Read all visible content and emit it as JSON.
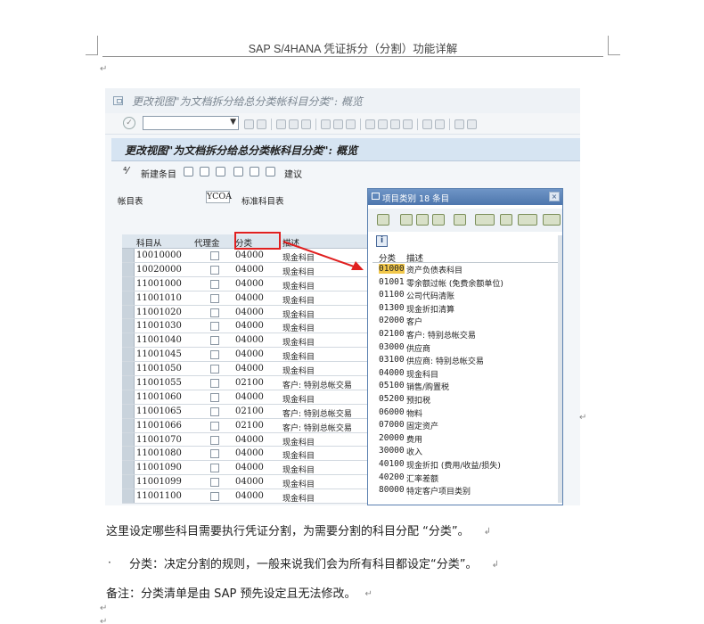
{
  "doc": {
    "header": "SAP S/4HANA 凭证拆分（分割）功能详解",
    "para_mark": "↵",
    "para_mark_alt": "↲"
  },
  "sap": {
    "window_title": "更改视图\"为文档拆分给总分类帐科目分类\": 概览",
    "view_title": "更改视图\"为文档拆分给总分类帐科目分类\": 概览",
    "toolbar": {
      "new_entry": "新建条目",
      "info": "建议"
    },
    "ledger": {
      "label": "帐目表",
      "value": "YCOA",
      "desc": "标准科目表"
    },
    "grid": {
      "headers": {
        "account_from": "科目从",
        "agent": "代理金",
        "category": "分类",
        "desc": "描述"
      },
      "rows": [
        {
          "account": "10010000",
          "category": "04000",
          "desc": "现金科目"
        },
        {
          "account": "10020000",
          "category": "04000",
          "desc": "现金科目"
        },
        {
          "account": "11001000",
          "category": "04000",
          "desc": "现金科目"
        },
        {
          "account": "11001010",
          "category": "04000",
          "desc": "现金科目"
        },
        {
          "account": "11001020",
          "category": "04000",
          "desc": "现金科目"
        },
        {
          "account": "11001030",
          "category": "04000",
          "desc": "现金科目"
        },
        {
          "account": "11001040",
          "category": "04000",
          "desc": "现金科目"
        },
        {
          "account": "11001045",
          "category": "04000",
          "desc": "现金科目"
        },
        {
          "account": "11001050",
          "category": "04000",
          "desc": "现金科目"
        },
        {
          "account": "11001055",
          "category": "02100",
          "desc": "客户: 特别总帐交易"
        },
        {
          "account": "11001060",
          "category": "04000",
          "desc": "现金科目"
        },
        {
          "account": "11001065",
          "category": "02100",
          "desc": "客户: 特别总帐交易"
        },
        {
          "account": "11001066",
          "category": "02100",
          "desc": "客户: 特别总帐交易"
        },
        {
          "account": "11001070",
          "category": "04000",
          "desc": "现金科目"
        },
        {
          "account": "11001080",
          "category": "04000",
          "desc": "现金科目"
        },
        {
          "account": "11001090",
          "category": "04000",
          "desc": "现金科目"
        },
        {
          "account": "11001099",
          "category": "04000",
          "desc": "现金科目"
        },
        {
          "account": "11001100",
          "category": "04000",
          "desc": "现金科目"
        }
      ]
    },
    "popup": {
      "title": "项目类别 18 条目",
      "close": "×",
      "info_icon": "i",
      "headers": {
        "code": "分类",
        "desc": "描述"
      },
      "items": [
        {
          "code": "01000",
          "desc": "资产负债表科目"
        },
        {
          "code": "01001",
          "desc": "零余额过帐 (免费余额单位)"
        },
        {
          "code": "01100",
          "desc": "公司代码清账"
        },
        {
          "code": "01300",
          "desc": "现金折扣清算"
        },
        {
          "code": "02000",
          "desc": "客户"
        },
        {
          "code": "02100",
          "desc": "客户: 特别总帐交易"
        },
        {
          "code": "03000",
          "desc": "供应商"
        },
        {
          "code": "03100",
          "desc": "供应商: 特别总帐交易"
        },
        {
          "code": "04000",
          "desc": "现金科目"
        },
        {
          "code": "05100",
          "desc": "销售/购置税"
        },
        {
          "code": "05200",
          "desc": "预扣税"
        },
        {
          "code": "06000",
          "desc": "物料"
        },
        {
          "code": "07000",
          "desc": "固定资产"
        },
        {
          "code": "20000",
          "desc": "费用"
        },
        {
          "code": "30000",
          "desc": "收入"
        },
        {
          "code": "40100",
          "desc": "现金折扣 (费用/收益/损失)"
        },
        {
          "code": "40200",
          "desc": "汇率差额"
        },
        {
          "code": "80000",
          "desc": "特定客户项目类别"
        }
      ]
    }
  },
  "body": {
    "line1": "这里设定哪些科目需要执行凭证分割，为需要分割的科目分配 “分类”。",
    "bullet": "·",
    "line2": "分类：决定分割的规则，一般来说我们会为所有科目都设定“分类”。",
    "line3": "备注：分类清单是由 SAP 预先设定且无法修改。"
  },
  "colors": {
    "highlight_box": "#e02020",
    "selected_code": "#f2c84b",
    "popup_title": "#4d76ad"
  }
}
